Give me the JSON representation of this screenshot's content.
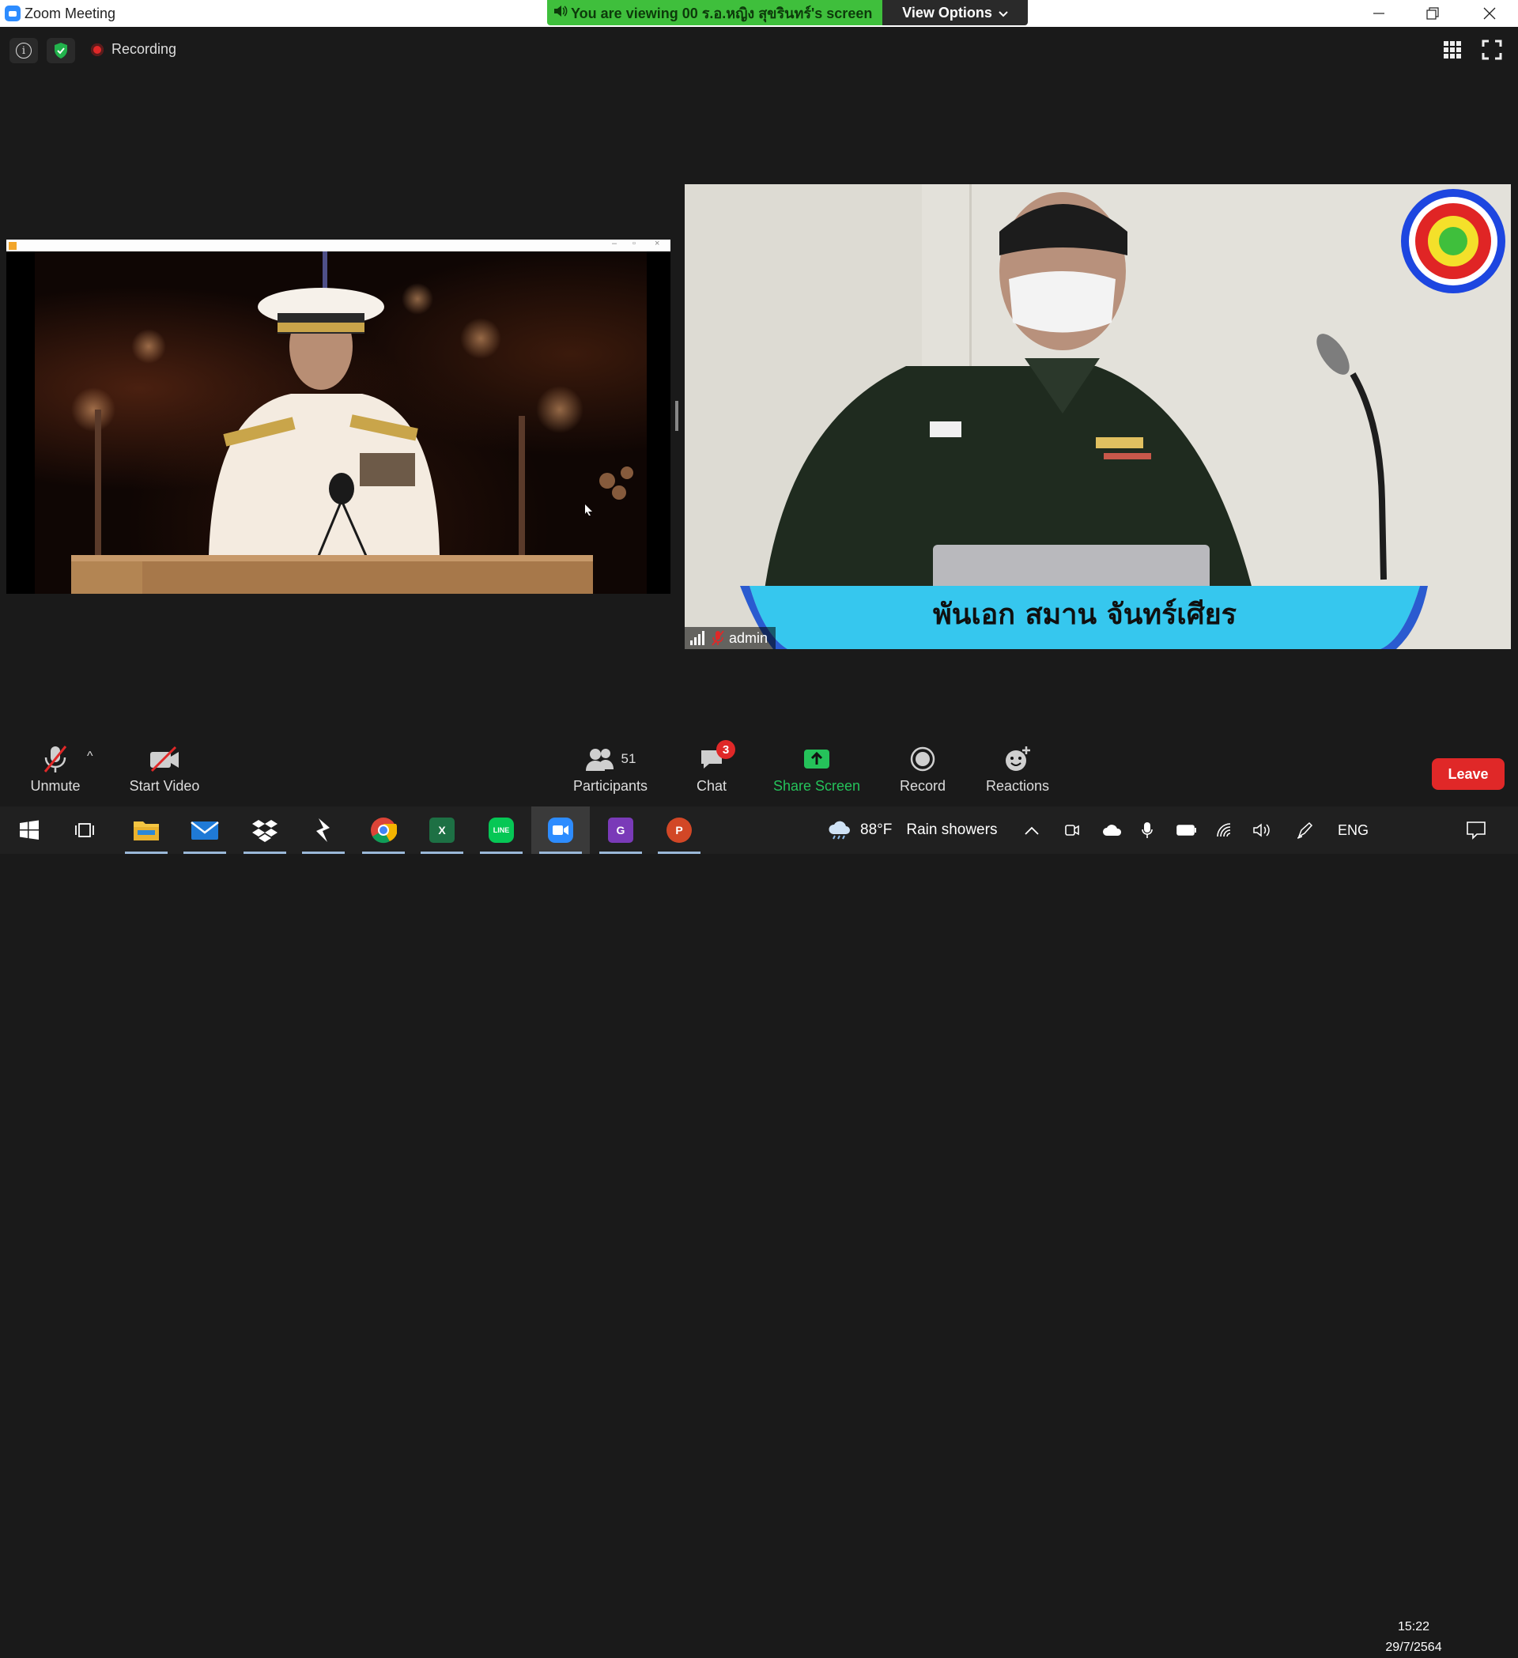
{
  "window": {
    "title": "Zoom Meeting",
    "viewing_banner": "You are viewing 00 ร.อ.หญิง สุขรินทร์'s screen",
    "view_options_label": "View Options",
    "chevron": "⌄",
    "controls": {
      "minimize": "—",
      "restore": "❐",
      "close": "✕"
    }
  },
  "meeting": {
    "info_icon_glyph": "i",
    "recording_label": "Recording"
  },
  "video": {
    "caption": "พันเอก สมาน  จันทร์เศียร",
    "name": "admin"
  },
  "toolbar": {
    "unmute": "Unmute",
    "start_video": "Start Video",
    "participants": "Participants",
    "participants_count": "51",
    "chat": "Chat",
    "chat_badge": "3",
    "share_screen": "Share Screen",
    "record": "Record",
    "reactions": "Reactions",
    "leave": "Leave",
    "caret": "^"
  },
  "taskbar": {
    "weather_temp": "88°F",
    "weather_text": "Rain showers",
    "language": "ENG",
    "time": "15:22",
    "date": "29/7/2564",
    "apps": [
      "start-icon",
      "task-view-icon",
      "file-explorer-icon",
      "mail-icon",
      "dropbox-icon",
      "app-icon",
      "chrome-icon",
      "excel-icon",
      "line-icon",
      "zoom-icon",
      "pdf-icon",
      "powerpoint-icon"
    ],
    "app_letters": {
      "excel": "X",
      "line": "LINE",
      "pdf": "G",
      "powerpoint": "P"
    }
  },
  "colors": {
    "banner_green": "#3fbf3c",
    "leave_red": "#e02828",
    "share_green": "#25c25a",
    "caption_cyan": "#36c7ee",
    "zoom_blue": "#2d8cff"
  }
}
